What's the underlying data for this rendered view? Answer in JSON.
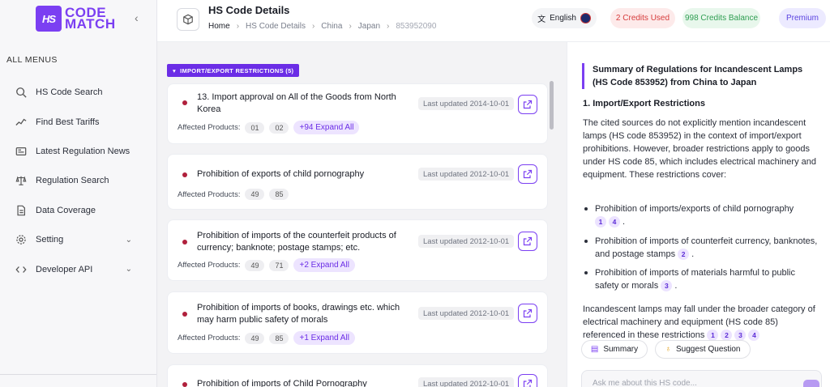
{
  "brand": {
    "mark": "HS",
    "line1": "CODE",
    "line2": "MATCH"
  },
  "sidebar": {
    "menus_title": "ALL MENUS",
    "items": [
      {
        "label": "HS Code Search",
        "icon": "search-icon"
      },
      {
        "label": "Find Best Tariffs",
        "icon": "trend-icon"
      },
      {
        "label": "Latest Regulation News",
        "icon": "newspaper-icon"
      },
      {
        "label": "Regulation Search",
        "icon": "scale-icon"
      },
      {
        "label": "Data Coverage",
        "icon": "document-icon"
      },
      {
        "label": "Setting",
        "icon": "gear-icon",
        "chevron": "⌄"
      },
      {
        "label": "Developer API",
        "icon": "code-icon",
        "chevron": "⌄"
      }
    ]
  },
  "header": {
    "title": "HS Code Details",
    "breadcrumb": [
      "Home",
      "HS Code Details",
      "China",
      "Japan",
      "853952090"
    ],
    "language": "English",
    "credits_used": "2 Credits Used",
    "credits_balance": "998 Credits Balance",
    "plan": "Premium"
  },
  "section": {
    "label": "IMPORT/EXPORT RESTRICTIONS (5)"
  },
  "affected_label": "Affected Products:",
  "cards": [
    {
      "title": "13. Import approval on All of the Goods from North Korea",
      "updated": "Last updated 2014-10-01",
      "chips": [
        "01",
        "02"
      ],
      "expand": "+94 Expand All"
    },
    {
      "title": "Prohibition of exports of child pornography",
      "updated": "Last updated 2012-10-01",
      "chips": [
        "49",
        "85"
      ],
      "expand": ""
    },
    {
      "title": "Prohibition of imports of the counterfeit products of currency; banknote; postage stamps; etc.",
      "updated": "Last updated 2012-10-01",
      "chips": [
        "49",
        "71"
      ],
      "expand": "+2 Expand All"
    },
    {
      "title": "Prohibition of imports of books, drawings etc. which may harm public safety of morals",
      "updated": "Last updated 2012-10-01",
      "chips": [
        "49",
        "85"
      ],
      "expand": "+1 Expand All"
    },
    {
      "title": "Prohibition of imports of Child Pornography",
      "updated": "Last updated 2012-10-01",
      "chips": [],
      "expand": ""
    }
  ],
  "summary": {
    "title": "Summary of Regulations for Incandescent Lamps (HS Code 853952) from China to Japan",
    "subtitle": "1. Import/Export Restrictions",
    "intro": "The cited sources do not explicitly mention incandescent lamps (HS code 853952) in the context of import/export prohibitions. However, broader restrictions apply to goods under HS code 85, which includes electrical machinery and equipment. These restrictions cover:",
    "bullets": [
      {
        "text": "Prohibition of imports/exports of child pornography",
        "cites": [
          "1",
          "4"
        ]
      },
      {
        "text": "Prohibition of imports of counterfeit currency, banknotes, and postage stamps",
        "cites": [
          "2"
        ]
      },
      {
        "text": "Prohibition of imports of materials harmful to public safety or morals",
        "cites": [
          "3"
        ]
      }
    ],
    "outro": "Incandescent lamps may fall under the broader category of electrical machinery and equipment (HS code 85) referenced in these restrictions",
    "outro_cites": [
      "1",
      "2",
      "3",
      "4"
    ],
    "summary_btn": "Summary",
    "suggest_btn": "Suggest Question",
    "ask_placeholder": "Ask me about this HS code..."
  }
}
